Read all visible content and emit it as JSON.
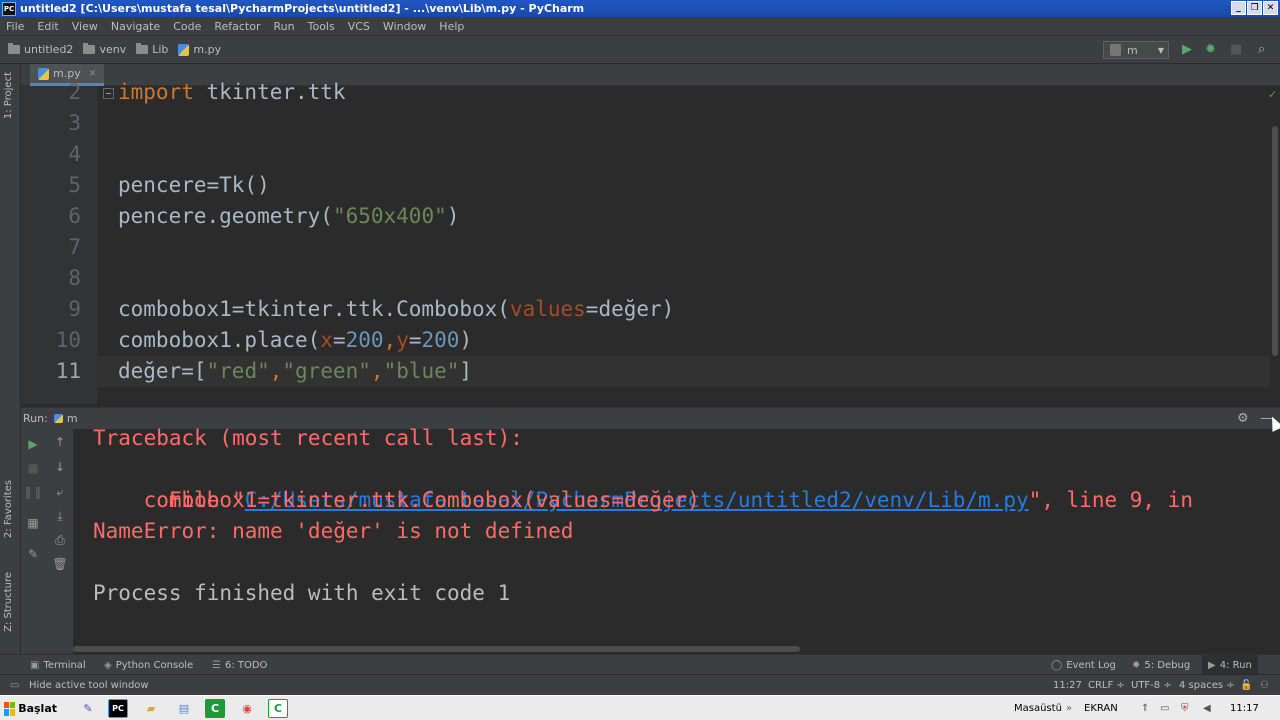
{
  "titlebar": {
    "app_icon": "PC",
    "title": "untitled2 [C:\\Users\\mustafa tesal\\PycharmProjects\\untitled2] - ...\\venv\\Lib\\m.py - PyCharm"
  },
  "menu": [
    "File",
    "Edit",
    "View",
    "Navigate",
    "Code",
    "Refactor",
    "Run",
    "Tools",
    "VCS",
    "Window",
    "Help"
  ],
  "breadcrumbs": [
    "untitled2",
    "venv",
    "Lib",
    "m.py"
  ],
  "run_config": {
    "selected": "m"
  },
  "left_stripe": {
    "project": "1: Project",
    "favorites": "2: Favorites",
    "structure": "Z: Structure"
  },
  "editor": {
    "tab": "m.py",
    "lines": [
      {
        "num": "2",
        "parts": [
          {
            "t": "import",
            "c": "kw"
          },
          {
            "t": " tkinter.ttk",
            "c": ""
          }
        ]
      },
      {
        "num": "3",
        "parts": []
      },
      {
        "num": "4",
        "parts": []
      },
      {
        "num": "5",
        "parts": [
          {
            "t": "pencere=Tk()",
            "c": ""
          }
        ]
      },
      {
        "num": "6",
        "parts": [
          {
            "t": "pencere.geometry(",
            "c": ""
          },
          {
            "t": "\"650x400\"",
            "c": "str"
          },
          {
            "t": ")",
            "c": ""
          }
        ]
      },
      {
        "num": "7",
        "parts": []
      },
      {
        "num": "8",
        "parts": []
      },
      {
        "num": "9",
        "parts": [
          {
            "t": "combobox1=tkinter.ttk.Combobox(",
            "c": ""
          },
          {
            "t": "values",
            "c": "param"
          },
          {
            "t": "=değer)",
            "c": ""
          }
        ]
      },
      {
        "num": "10",
        "parts": [
          {
            "t": "combobox1.place(",
            "c": ""
          },
          {
            "t": "x",
            "c": "param"
          },
          {
            "t": "=",
            "c": ""
          },
          {
            "t": "200",
            "c": "num"
          },
          {
            "t": ",",
            "c": "kw"
          },
          {
            "t": "y",
            "c": "param"
          },
          {
            "t": "=",
            "c": ""
          },
          {
            "t": "200",
            "c": "num"
          },
          {
            "t": ")",
            "c": ""
          }
        ]
      },
      {
        "num": "11",
        "parts": [
          {
            "t": "değer=[",
            "c": ""
          },
          {
            "t": "\"red\"",
            "c": "str"
          },
          {
            "t": ",",
            "c": "kw"
          },
          {
            "t": "\"green\"",
            "c": "str"
          },
          {
            "t": ",",
            "c": "kw"
          },
          {
            "t": "\"blue\"",
            "c": "str"
          },
          {
            "t": "]",
            "c": ""
          }
        ],
        "current": true
      }
    ]
  },
  "run_panel": {
    "label": "Run:",
    "config": "m",
    "console": {
      "traceback": "Traceback (most recent call last):",
      "file_prefix": "  File \"",
      "file_link": "C:/Users/mustafa tesal/PycharmProjects/untitled2/venv/Lib/m.py",
      "file_suffix": "\", line 9, in",
      "code_line": "    combobox1=tkinter.ttk.Combobox(values=değer)",
      "error": "NameError: name 'değer' is not defined",
      "finished": "Process finished with exit code 1"
    }
  },
  "bottom_tabs": [
    {
      "label": "Terminal",
      "icon": "terminal-icon"
    },
    {
      "label": "Python Console",
      "icon": "python-console-icon"
    },
    {
      "label": "6: TODO",
      "icon": "todo-icon"
    },
    {
      "label": "Event Log",
      "icon": "event-log-icon"
    },
    {
      "label": "5: Debug",
      "icon": "debug-icon"
    },
    {
      "label": "4: Run",
      "icon": "run-icon"
    }
  ],
  "status": {
    "hint": "Hide active tool window",
    "position": "11:27",
    "line_sep": "CRLF ÷",
    "encoding": "UTF-8 ÷",
    "indent": "4 spaces ÷"
  },
  "taskbar": {
    "start": "Başlat",
    "desktop": "Masaüstü",
    "ekran": "EKRAN",
    "clock": "11:17"
  },
  "colors": {
    "accent": "#4a88c7",
    "error": "#ff6b68",
    "link": "#287bde",
    "keyword": "#cc7832",
    "string": "#6a8759"
  }
}
